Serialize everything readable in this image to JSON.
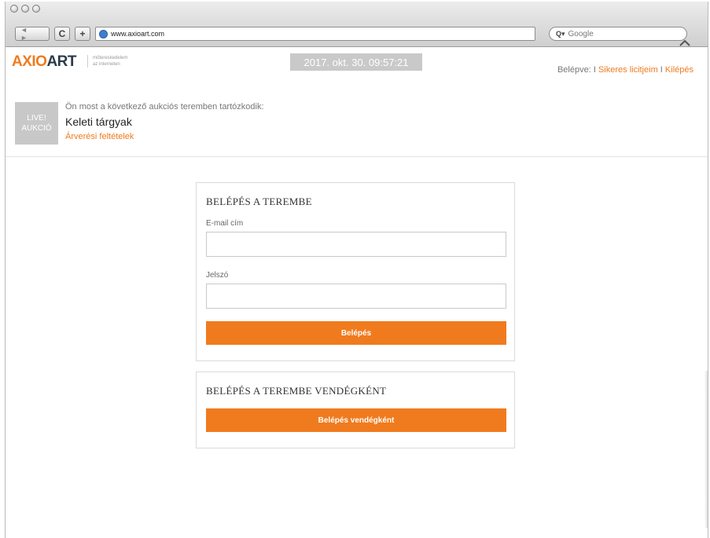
{
  "browser": {
    "url": "www.axioart.com",
    "search_placeholder": "Google",
    "nav_back_forward": "◄ ►",
    "reload_glyph": "C",
    "add_glyph": "+"
  },
  "header": {
    "logo_part1": "AXIO",
    "logo_part2": "ART",
    "tagline_line1": "műtereskedelem",
    "tagline_line2": "az interneten",
    "clock": "2017. okt. 30. 09:57:21",
    "logged_in_label": "Belépve: I ",
    "link_successful_bids": "Sikeres licitjeim",
    "separator": " I ",
    "link_logout": "Kilépés"
  },
  "auction": {
    "badge_line1": "LIVE!",
    "badge_line2": "AUKCIÓ",
    "intro": "Ön most a következő aukciós teremben tartózkodik:",
    "room_name": "Keleti tárgyak",
    "terms_link": "Árverési feltételek"
  },
  "login_panel": {
    "title": "BELÉPÉS A TEREMBE",
    "email_label": "E-mail cím",
    "email_value": "",
    "password_label": "Jelszó",
    "password_value": "",
    "submit_label": "Belépés"
  },
  "guest_panel": {
    "title": "BELÉPÉS A TEREMBE VENDÉGKÉNT",
    "submit_label": "Belépés vendégként"
  },
  "colors": {
    "accent": "#f07b1e",
    "badge_bg": "#c8c8c8",
    "clock_bg": "#c9c9c9"
  }
}
